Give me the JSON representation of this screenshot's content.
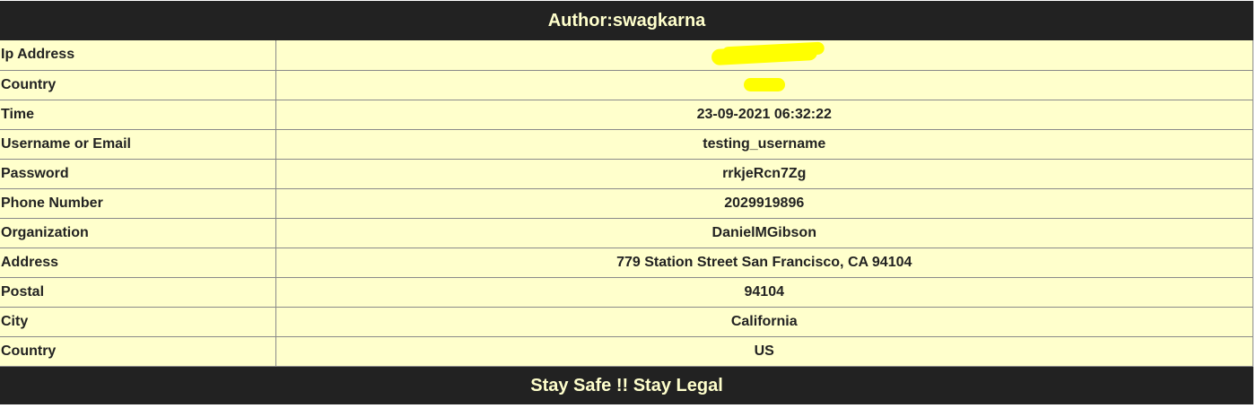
{
  "header": {
    "title": "Author:swagkarna"
  },
  "rows": [
    {
      "label": "Ip Address",
      "value": "",
      "redacted": true
    },
    {
      "label": "Country",
      "value": "",
      "redacted": true
    },
    {
      "label": "Time",
      "value": "23-09-2021 06:32:22"
    },
    {
      "label": "Username or Email",
      "value": "testing_username"
    },
    {
      "label": "Password",
      "value": "rrkjeRcn7Zg"
    },
    {
      "label": "Phone Number",
      "value": "2029919896"
    },
    {
      "label": "Organization",
      "value": "DanielMGibson"
    },
    {
      "label": "Address",
      "value": "779 Station Street San Francisco, CA 94104"
    },
    {
      "label": "Postal",
      "value": "94104"
    },
    {
      "label": "City",
      "value": "California"
    },
    {
      "label": "Country",
      "value": "US"
    }
  ],
  "footer": {
    "text": "Stay Safe !! Stay Legal"
  },
  "colors": {
    "banner_bg": "#222222",
    "banner_text": "#ffffcc",
    "table_bg": "#ffffcc",
    "redaction": "#ffff00"
  }
}
